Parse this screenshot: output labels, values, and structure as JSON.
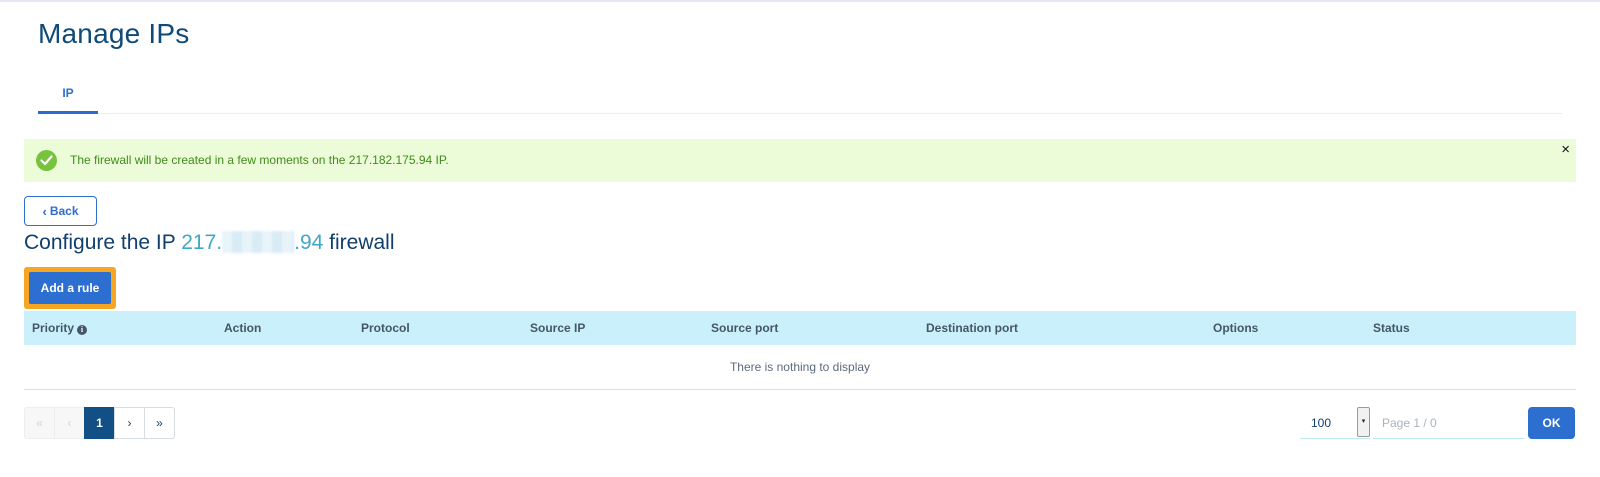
{
  "page": {
    "title": "Manage IPs"
  },
  "tabs": [
    {
      "label": "IP",
      "active": true
    }
  ],
  "alert": {
    "type": "success",
    "message": "The firewall will be created in a few moments on the 217.182.175.94 IP.",
    "close_glyph": "×"
  },
  "back_button": {
    "label": "Back"
  },
  "config": {
    "prefix": "Configure the IP",
    "ip_start": "217.",
    "ip_end": ".94",
    "suffix": "firewall"
  },
  "add_rule": {
    "label": "Add a rule"
  },
  "table": {
    "columns": [
      "Priority",
      "Action",
      "Protocol",
      "Source IP",
      "Source port",
      "Destination port",
      "Options",
      "Status"
    ],
    "empty_message": "There is nothing to display"
  },
  "pagination": {
    "current_page": "1",
    "page_size": "100",
    "page_input_placeholder": "Page 1 / 0",
    "ok_label": "OK"
  },
  "colors": {
    "primary": "#2d6fd1",
    "highlight": "#f6a623",
    "success_bg": "#ecfbd8",
    "success_icon": "#77c33e",
    "table_header_bg": "#c9f0fb",
    "active_page": "#124f84",
    "ip_link": "#3fa8c7"
  }
}
